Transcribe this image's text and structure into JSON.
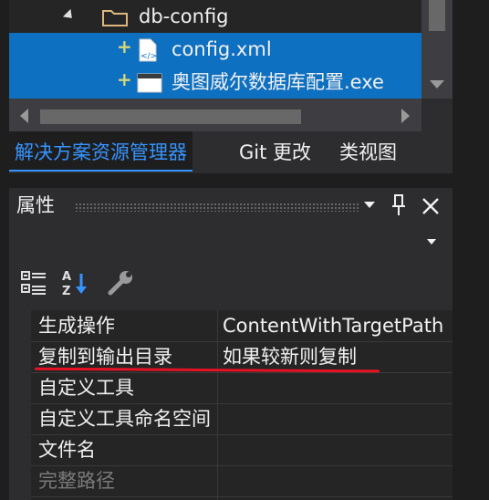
{
  "tree": {
    "folder": "db-config",
    "items": [
      {
        "label": "config.xml",
        "icon": "xml-file-icon"
      },
      {
        "label": "奥图威尔数据库配置.exe",
        "icon": "exe-window-icon"
      }
    ]
  },
  "tabs": [
    {
      "label": "解决方案资源管理器",
      "active": true
    },
    {
      "label": "Git 更改",
      "active": false
    },
    {
      "label": "类视图",
      "active": false
    }
  ],
  "properties": {
    "title": "属性",
    "rows": [
      {
        "name": "生成操作",
        "value": "ContentWithTargetPath"
      },
      {
        "name": "复制到输出目录",
        "value": "如果较新则复制"
      },
      {
        "name": "自定义工具",
        "value": ""
      },
      {
        "name": "自定义工具命名空间",
        "value": ""
      },
      {
        "name": "文件名",
        "value": ""
      },
      {
        "name": "完整路径",
        "value": ""
      }
    ]
  },
  "colors": {
    "selection": "#0e70c0",
    "active_tab": "#3794ff",
    "annotation": "#e81123"
  }
}
